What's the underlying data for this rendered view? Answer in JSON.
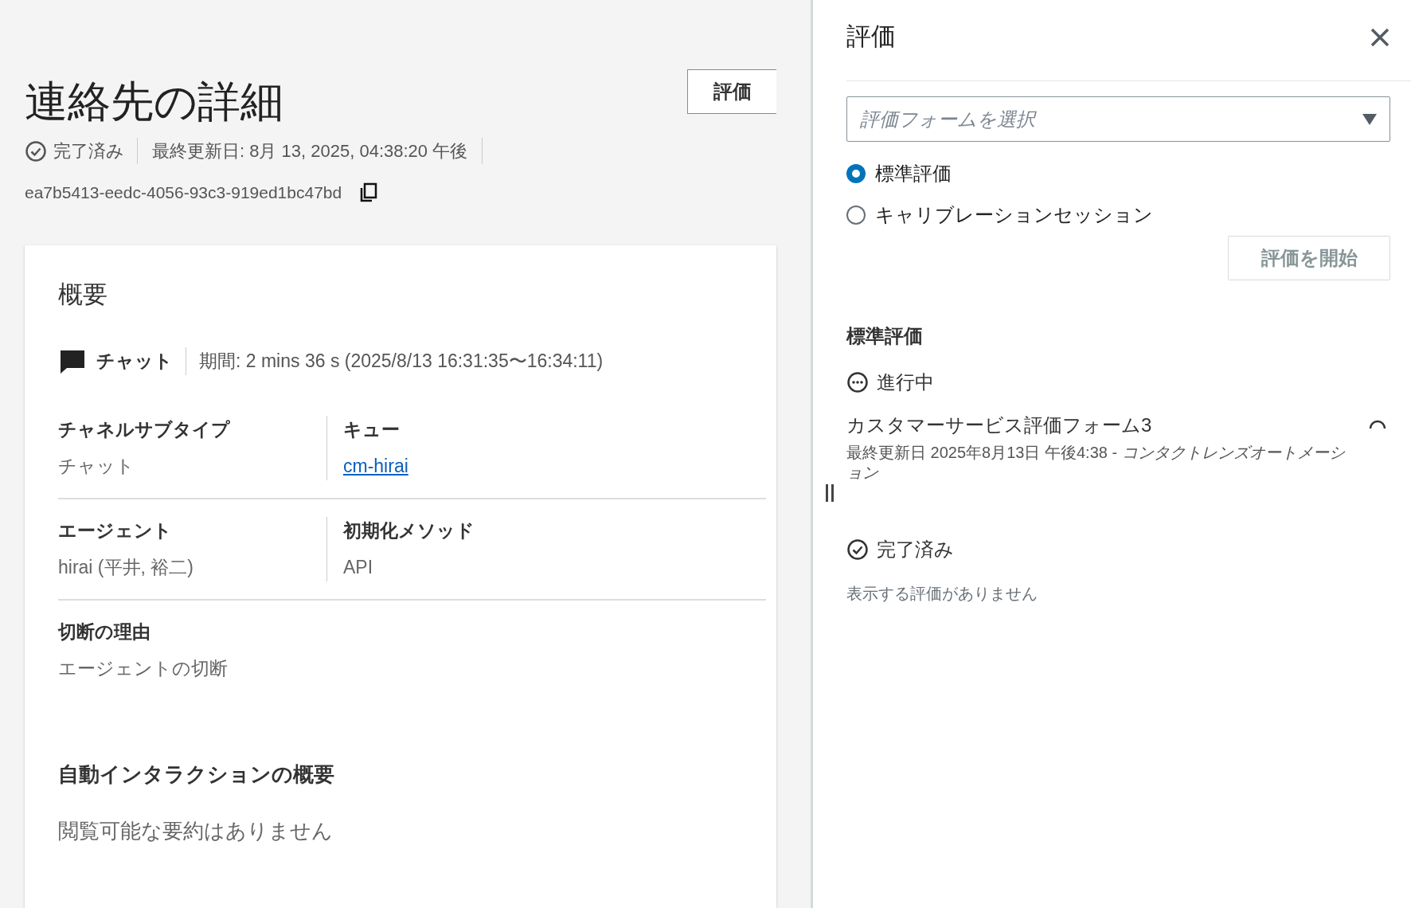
{
  "page": {
    "title": "連絡先の詳細",
    "evaluate_button": "評価",
    "status": {
      "label": "完了済み"
    },
    "last_updated": "最終更新日: 8月 13, 2025, 04:38:20 午後",
    "contact_id": "ea7b5413-eedc-4056-93c3-919ed1bc47bd"
  },
  "overview": {
    "title": "概要",
    "channel": "チャット",
    "duration": "期間: 2 mins 36 s (2025/8/13 16:31:35〜16:34:11)",
    "field_rows": [
      {
        "cells": [
          {
            "label": "チャネルサブタイプ",
            "value": "チャット",
            "kind": "text"
          },
          {
            "label": "キュー",
            "value": "cm-hirai",
            "kind": "link"
          }
        ]
      },
      {
        "cells": [
          {
            "label": "エージェント",
            "value": "hirai (平井, 裕二)",
            "kind": "text"
          },
          {
            "label": "初期化メソッド",
            "value": "API",
            "kind": "text"
          }
        ]
      },
      {
        "cells": [
          {
            "label": "切断の理由",
            "value": "エージェントの切断",
            "kind": "text"
          }
        ]
      }
    ],
    "auto_summary": {
      "title": "自動インタラクションの概要",
      "text": "閲覧可能な要約はありません"
    }
  },
  "panel": {
    "title": "評価",
    "select": {
      "placeholder": "評価フォームを選択"
    },
    "options": [
      {
        "label": "標準評価",
        "selected": true
      },
      {
        "label": "キャリブレーションセッション",
        "selected": false
      }
    ],
    "start_button": {
      "label": "評価を開始",
      "disabled": true
    },
    "section_title": "標準評価",
    "groups": [
      {
        "kind": "in_progress",
        "status": "進行中",
        "items": [
          {
            "name": "カスタマーサービス評価フォーム3",
            "meta": "最終更新日 2025年8月13日 午後4:38 - *コンタクトレンズオートメーション*",
            "loading": true
          }
        ]
      },
      {
        "kind": "completed",
        "status": "完了済み",
        "empty_text": "表示する評価がありません"
      }
    ]
  }
}
